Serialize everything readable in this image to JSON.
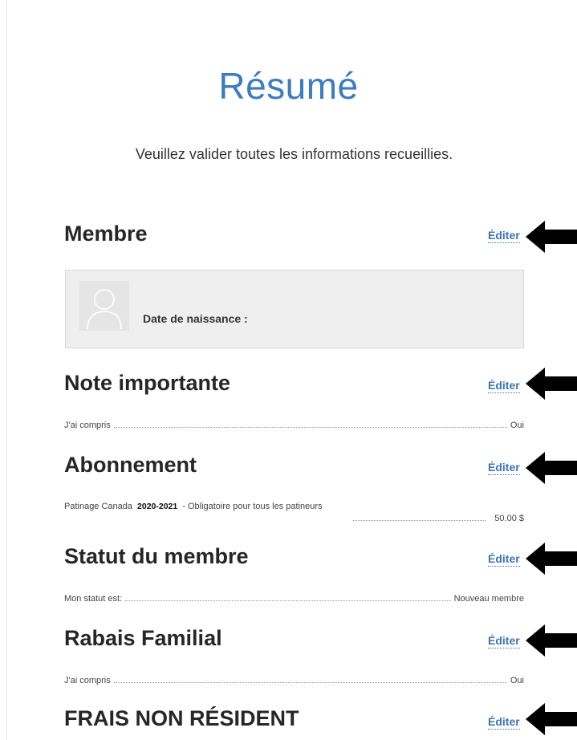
{
  "page": {
    "title": "Résumé",
    "subtitle": "Veuillez valider toutes les informations recueillies.",
    "edit_label": "Éditer",
    "accent_color": "#3b7cc2"
  },
  "sections": {
    "membre": {
      "heading": "Membre",
      "dob_label": "Date de naissance :"
    },
    "note": {
      "heading": "Note importante",
      "label": "J'ai compris",
      "value": "Oui"
    },
    "abonnement": {
      "heading": "Abonnement",
      "item_name": "Patinage Canada",
      "season": "2020-2021",
      "item_desc": "- Obligatoire pour tous les patineurs",
      "price": "50.00 $"
    },
    "statut": {
      "heading": "Statut du membre",
      "label": "Mon statut est:",
      "value": "Nouveau membre"
    },
    "rabais": {
      "heading": "Rabais Familial",
      "label": "J'ai compris",
      "value": "Oui"
    },
    "frais": {
      "heading": "FRAIS NON RÉSIDENT"
    }
  },
  "icons": {
    "arrow": "arrow-left-icon",
    "avatar": "user-placeholder-icon"
  }
}
